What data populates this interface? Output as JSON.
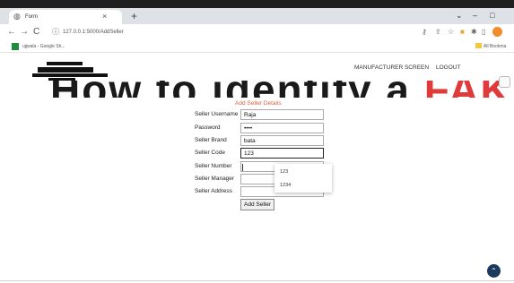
{
  "browser": {
    "tab_title": "Form",
    "tab_close": "×",
    "new_tab": "+",
    "window_controls": [
      "⌄",
      "–",
      "□"
    ],
    "nav": {
      "back": "←",
      "forward": "→",
      "reload": "C"
    },
    "url": "127.0.0.1:5000/AddSeller",
    "bookmark_label": "ujjwala - Google Sh...",
    "bookmark_right": "All Bookma",
    "profile_color": "#f28b2c"
  },
  "header": {
    "banner_prefix": "How to identify a ",
    "banner_highlight": "FAKE",
    "nav_links": [
      "MANUFACTURER SCREEN",
      "LOGOUT"
    ]
  },
  "form": {
    "title": "Add Seller Details",
    "fields": [
      {
        "label": "Seller Username",
        "value": "Raja",
        "type": "text"
      },
      {
        "label": "Password",
        "value": "pass",
        "type": "password"
      },
      {
        "label": "Seller Brand",
        "value": "bata",
        "type": "text"
      },
      {
        "label": "Seller Code",
        "value": "123",
        "type": "text"
      },
      {
        "label": "Seller Number",
        "value": "",
        "type": "text"
      },
      {
        "label": "Seller Manager",
        "value": "",
        "type": "text"
      },
      {
        "label": "Seller Address",
        "value": "",
        "type": "text"
      }
    ],
    "autocomplete_options": [
      "123",
      "1234"
    ],
    "submit_label": "Add Seller"
  },
  "colors": {
    "accent": "#e0613d",
    "fake_red": "#e03a3a",
    "scroll_button": "#1b3a5c"
  },
  "icons": {
    "scroll_top": "chevron-up-icon"
  }
}
